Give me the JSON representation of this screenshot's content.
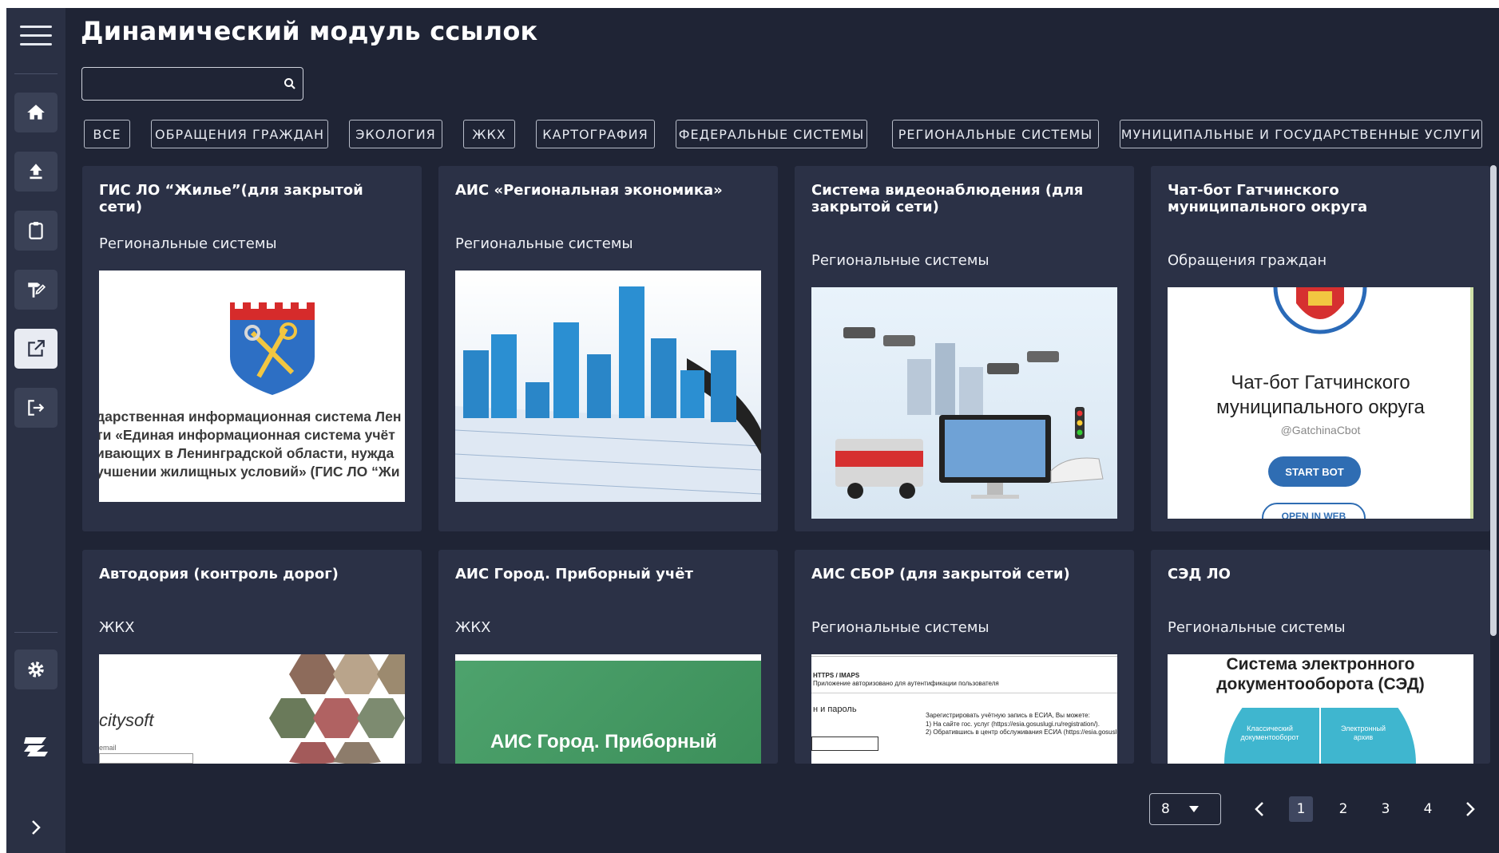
{
  "app": {
    "title": "Динамический модуль ссылок"
  },
  "search": {
    "placeholder": "",
    "value": ""
  },
  "sidebar": {
    "items": [
      {
        "name": "home",
        "icon": "home-icon"
      },
      {
        "name": "upload",
        "icon": "upload-icon"
      },
      {
        "name": "clipboard",
        "icon": "clipboard-icon"
      },
      {
        "name": "signpost",
        "icon": "signpost-icon"
      },
      {
        "name": "links",
        "icon": "external-link-icon",
        "active": true
      },
      {
        "name": "logout",
        "icon": "logout-icon"
      },
      {
        "name": "settings",
        "icon": "gear-icon"
      }
    ]
  },
  "filters": [
    "ВСЕ",
    "ОБРАЩЕНИЯ ГРАЖДАН",
    "ЭКОЛОГИЯ",
    "ЖКХ",
    "КАРТОГРАФИЯ",
    "ФЕДЕРАЛЬНЫЕ СИСТЕМЫ",
    "РЕГИОНАЛЬНЫЕ СИСТЕМЫ",
    "МУНИЦИПАЛЬНЫЕ И ГОСУДАРСТВЕННЫЕ УСЛУГИ"
  ],
  "cards": [
    {
      "title": "ГИС ЛО “Жилье”(для закрытой сети)",
      "category": "Региональные системы",
      "image_text": [
        "дарственная информационная система Лен",
        "ти «Единая информационная система учёт",
        "ивающих в Ленинградской области, нужда",
        "учшении жилищных условий» (ГИС ЛО “Жи"
      ]
    },
    {
      "title": "АИС «Региональная экономика»",
      "category": "Региональные системы",
      "image_text": []
    },
    {
      "title": "Система видеонаблюдения (для закрытой сети)",
      "category": "Региональные системы",
      "image_text": []
    },
    {
      "title": "Чат-бот Гатчинского муниципального округа",
      "category": "Обращения граждан",
      "image_text": [
        "Чат-бот Гатчинского",
        "муниципального округа",
        "@GatchinaCbot",
        "START BOT",
        "OPEN IN WEB"
      ]
    },
    {
      "title": "Автодория (контроль дорог)",
      "category": "ЖКХ",
      "image_text": [
        "citysoft",
        "email"
      ]
    },
    {
      "title": "АИС Город. Приборный учёт",
      "category": "ЖКХ",
      "image_text": [
        "АИС Город. Приборный"
      ]
    },
    {
      "title": "АИС СБОР (для закрытой сети)",
      "category": "Региональные системы",
      "image_text": [
        "HTTPS / IMAPS",
        "Приложение авторизовано для аутентификации пользователя",
        "н и пароль",
        "Зарегистрировать учётную запись в ЕСИА, Вы можете:",
        "1) На сайте гос. услуг (https://esia.gosuslugi.ru/registration/).",
        "2) Обратившись в центр обслуживания ЕСИА (https://esia.gosuslu"
      ]
    },
    {
      "title": "СЭД ЛО",
      "category": "Региональные системы",
      "image_text": [
        "Система электронного",
        "документооборота (СЭД)",
        "Классический документооборот",
        "Электронный архив"
      ]
    }
  ],
  "pagination": {
    "page_size": "8",
    "pages": [
      "1",
      "2",
      "3",
      "4"
    ],
    "current": "1"
  },
  "colors": {
    "background": "#1f2435",
    "sidebar": "#2a3044",
    "card": "#2b3146",
    "accent_blue": "#2f6db3"
  }
}
